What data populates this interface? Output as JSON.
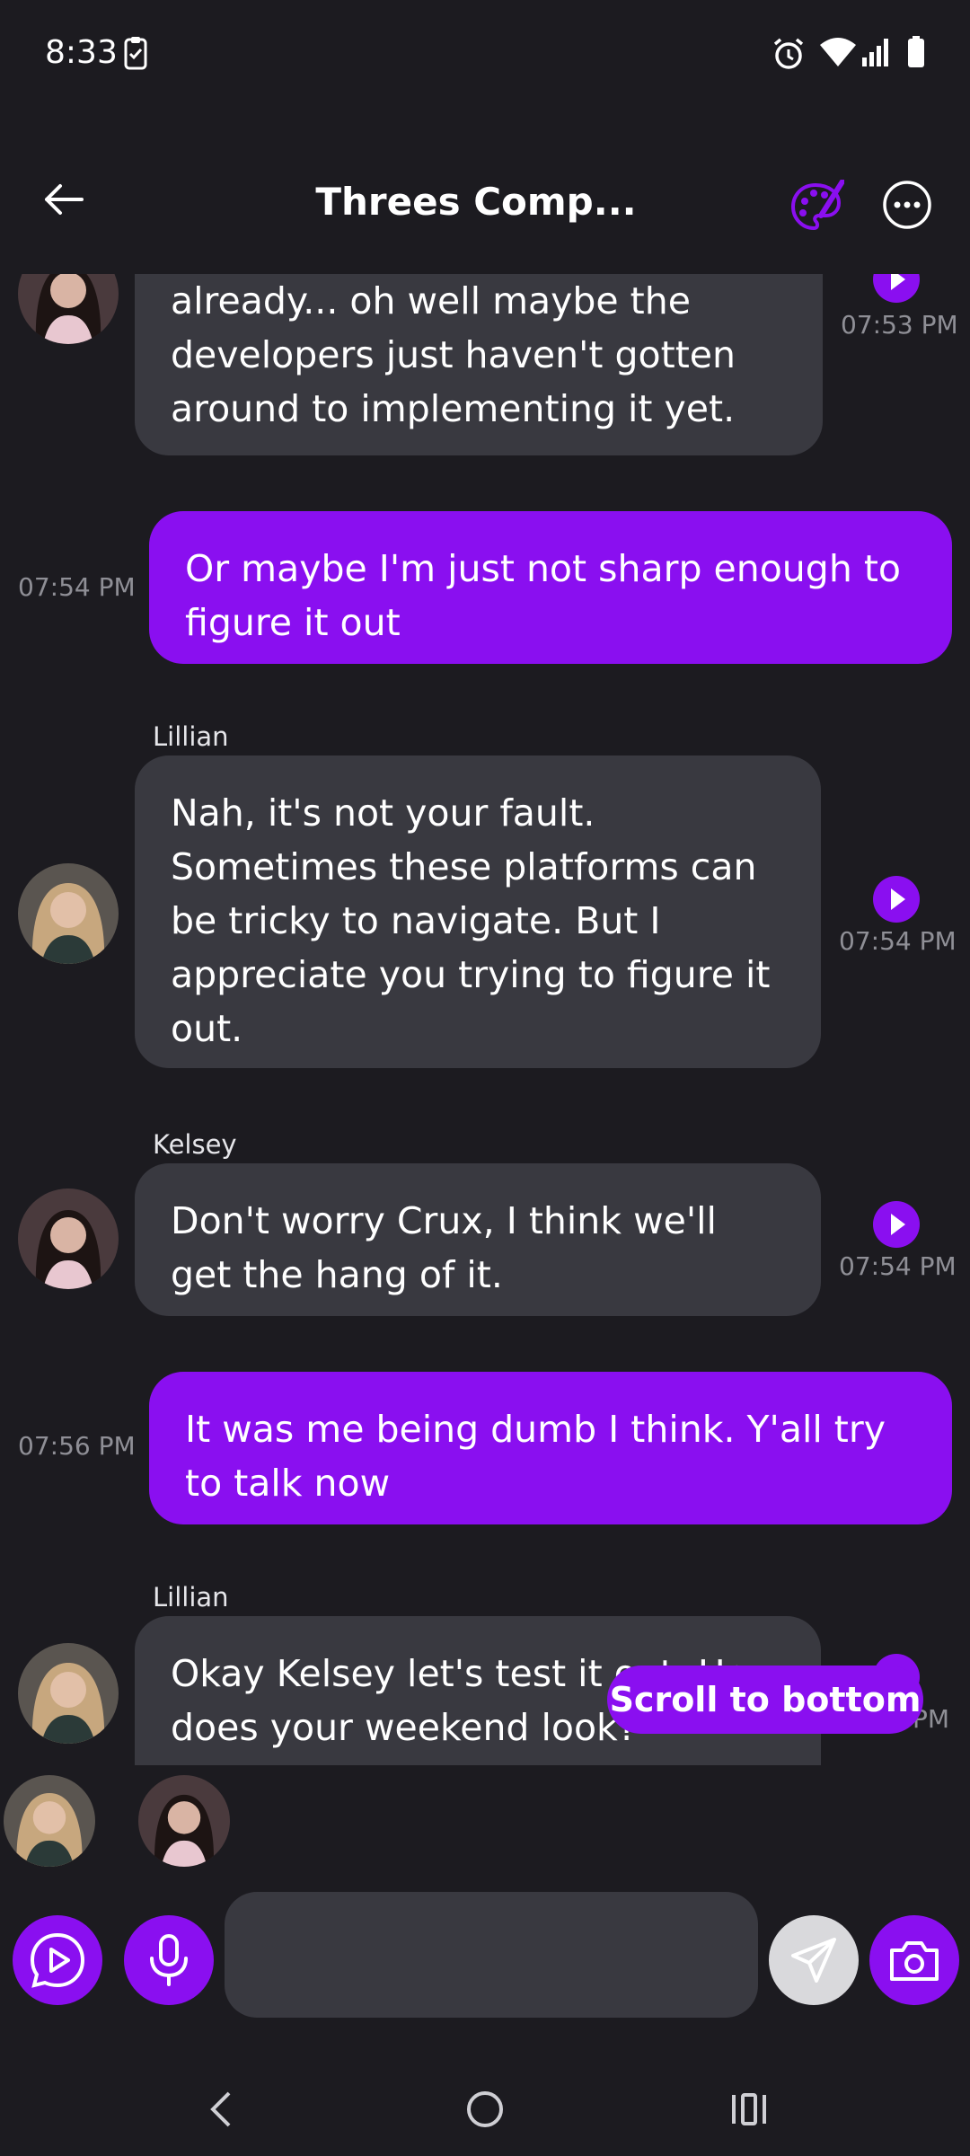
{
  "status": {
    "time": "8:33"
  },
  "header": {
    "title": "Threes Comp...",
    "accent": "#8a0ff0"
  },
  "messages": [
    {
      "id": "m1",
      "type": "incoming",
      "sender": "",
      "text": "already... oh well maybe the developers just haven't gotten around to implementing it yet.",
      "time": "07:53 PM",
      "avatar": "kelsey-avatar"
    },
    {
      "id": "m2",
      "type": "outgoing",
      "text": "Or maybe I'm just not sharp enough to figure it out",
      "time": "07:54 PM"
    },
    {
      "id": "m3",
      "type": "incoming",
      "sender": "Lillian",
      "text": "Nah, it's not your fault. Sometimes these platforms can be tricky to navigate. But I appreciate you trying to figure it out.",
      "time": "07:54 PM",
      "avatar": "lillian-avatar"
    },
    {
      "id": "m4",
      "type": "incoming",
      "sender": "Kelsey",
      "text": "Don't worry Crux, I think we'll get the hang of it.",
      "time": "07:54 PM",
      "avatar": "kelsey-avatar"
    },
    {
      "id": "m5",
      "type": "outgoing",
      "text": "It was me being dumb I think. Y'all try to talk now",
      "time": "07:56 PM"
    },
    {
      "id": "m6",
      "type": "incoming",
      "sender": "Lillian",
      "text": "Okay Kelsey let's test it out. How does your weekend look?",
      "time": "PM",
      "avatar": "lillian-avatar"
    }
  ],
  "scroll_to_bottom": "Scroll to bottom",
  "participants": [
    "lillian-avatar",
    "kelsey-avatar"
  ],
  "composer": {
    "placeholder": ""
  },
  "colors": {
    "bubble_in": "#393940",
    "bubble_out": "#8a0ff0",
    "background": "#1c1b20"
  }
}
